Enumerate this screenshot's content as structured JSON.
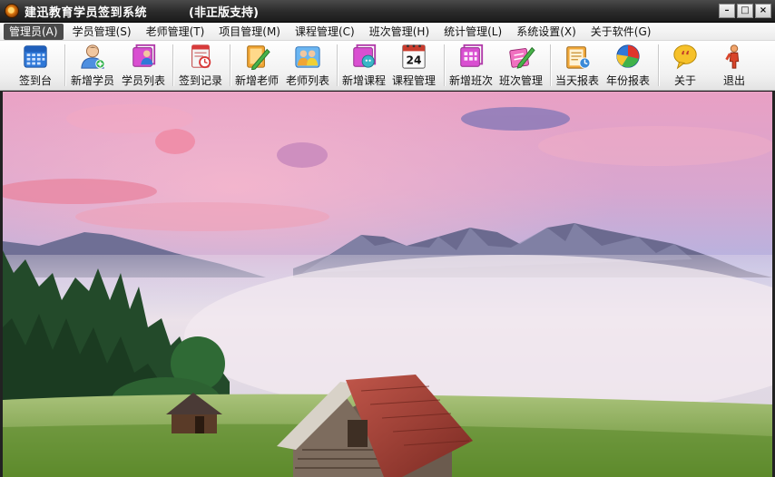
{
  "window": {
    "title": "建迅教育学员签到系统",
    "subtitle": "(非正版支持)",
    "controls": {
      "minimize": "–",
      "restore": "□",
      "close": "×"
    }
  },
  "menu": [
    {
      "label": "管理员(A)"
    },
    {
      "label": "学员管理(S)"
    },
    {
      "label": "老师管理(T)"
    },
    {
      "label": "项目管理(M)"
    },
    {
      "label": "课程管理(C)"
    },
    {
      "label": "班次管理(H)"
    },
    {
      "label": "统计管理(L)"
    },
    {
      "label": "系统设置(X)"
    },
    {
      "label": "关于软件(G)"
    }
  ],
  "toolbar": [
    {
      "label": "签到台",
      "icon": "calendar-icon"
    },
    {
      "label": "新增学员",
      "icon": "add-user-icon"
    },
    {
      "label": "学员列表",
      "icon": "user-list-icon"
    },
    {
      "label": "签到记录",
      "icon": "record-icon"
    },
    {
      "label": "新增老师",
      "icon": "add-teacher-icon"
    },
    {
      "label": "老师列表",
      "icon": "teacher-list-icon"
    },
    {
      "label": "新增课程",
      "icon": "add-course-icon"
    },
    {
      "label": "课程管理",
      "icon": "course-calendar-icon",
      "badge": "24"
    },
    {
      "label": "新增班次",
      "icon": "add-class-icon"
    },
    {
      "label": "班次管理",
      "icon": "class-edit-icon"
    },
    {
      "label": "当天报表",
      "icon": "daily-report-icon"
    },
    {
      "label": "年份报表",
      "icon": "yearly-report-icon"
    },
    {
      "label": "关于",
      "icon": "about-icon"
    },
    {
      "label": "退出",
      "icon": "exit-icon"
    }
  ],
  "colors": {
    "title_bar": "#2a2a2a",
    "menu_active": "#4a4a4a",
    "sky_pink": "#f2a6c0",
    "sky_blue": "#9fb3de"
  }
}
